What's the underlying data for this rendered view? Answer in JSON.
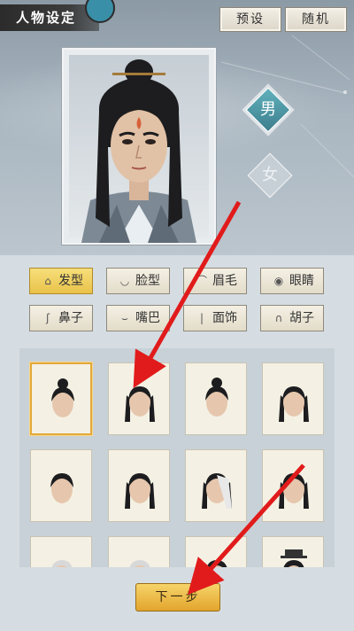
{
  "header": {
    "title": "人物设定",
    "preset_label": "预设",
    "random_label": "随机"
  },
  "gender": {
    "male_label": "男",
    "female_label": "女",
    "selected": "男"
  },
  "tabs": [
    {
      "label": "发型",
      "icon": "hair-icon",
      "active": true
    },
    {
      "label": "脸型",
      "icon": "face-shape-icon",
      "active": false
    },
    {
      "label": "眉毛",
      "icon": "eyebrow-icon",
      "active": false
    },
    {
      "label": "眼睛",
      "icon": "eye-icon",
      "active": false
    },
    {
      "label": "鼻子",
      "icon": "nose-icon",
      "active": false
    },
    {
      "label": "嘴巴",
      "icon": "mouth-icon",
      "active": false
    },
    {
      "label": "面饰",
      "icon": "face-decoration-icon",
      "active": false
    },
    {
      "label": "胡子",
      "icon": "beard-icon",
      "active": false
    }
  ],
  "hairstyles": {
    "selected_index": 0,
    "count": 12
  },
  "footer": {
    "next_label": "下一步"
  },
  "colors": {
    "accent": "#e9c24a",
    "arrow": "#e11b1b",
    "selected_border": "#e3a93a"
  }
}
